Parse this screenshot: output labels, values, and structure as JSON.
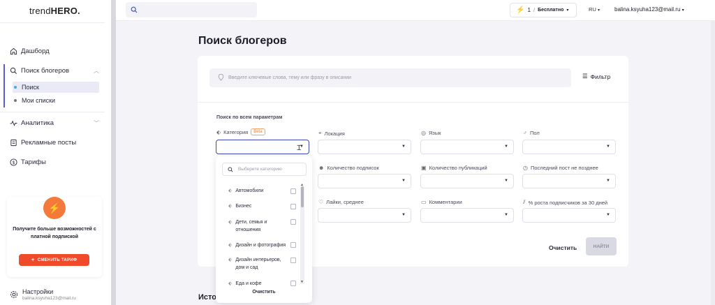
{
  "logo": {
    "prefix": "trend",
    "suffix": "HERO."
  },
  "sidebar": {
    "items": [
      {
        "label": "Дашборд"
      },
      {
        "label": "Поиск блогеров"
      },
      {
        "label": "Аналитика"
      },
      {
        "label": "Рекламные посты"
      },
      {
        "label": "Тарифы"
      }
    ],
    "subitems": [
      {
        "label": "Поиск"
      },
      {
        "label": "Мои списки"
      }
    ],
    "promo": {
      "text": "Получите больше возможностей с платной подпиской",
      "button": "СМЕНИТЬ ТАРИФ"
    },
    "settings": {
      "label": "Настройки",
      "email": "balina.ksyuha123@mail.ru"
    }
  },
  "topbar": {
    "credits": "1",
    "plan": "Бесплатно",
    "lang": "RU",
    "email": "balina.ksyuha123@mail.ru"
  },
  "main": {
    "title": "Поиск блогеров",
    "keyword_placeholder": "Введите ключевые слова, тему или фразу в описании",
    "filter_label": "Фильтр",
    "section_label": "Поиск по всем параметрам",
    "fields": {
      "category": "Категория",
      "beta": "Beta",
      "location": "Локация",
      "language": "Язык",
      "gender": "Пол",
      "followers": "Количество подписок",
      "publications": "Количество публикаций",
      "last_post": "Последний пост не позднее",
      "likes": "Лайки, среднее",
      "comments": "Комментарии",
      "growth": "% роста подписчиков за 30 дней"
    },
    "clear": "Очистить",
    "find": "НАЙТИ",
    "history": "Истор"
  },
  "dropdown": {
    "search_placeholder": "Выберите категорию",
    "items": [
      {
        "label": "Автомобили"
      },
      {
        "label": "Бизнес"
      },
      {
        "label": "Дети, семья и отношения"
      },
      {
        "label": "Дизайн и фотография"
      },
      {
        "label": "Дизайн интерьеров, дом и сад"
      },
      {
        "label": "Еда и кофе"
      }
    ],
    "clear": "Очистить"
  },
  "colors": {
    "accent": "#5b5bd6",
    "promo_button": "#ef4a2a",
    "promo_icon": "#f47a3c",
    "beta": "#f07a2c",
    "active_border": "#3b4bb3"
  }
}
